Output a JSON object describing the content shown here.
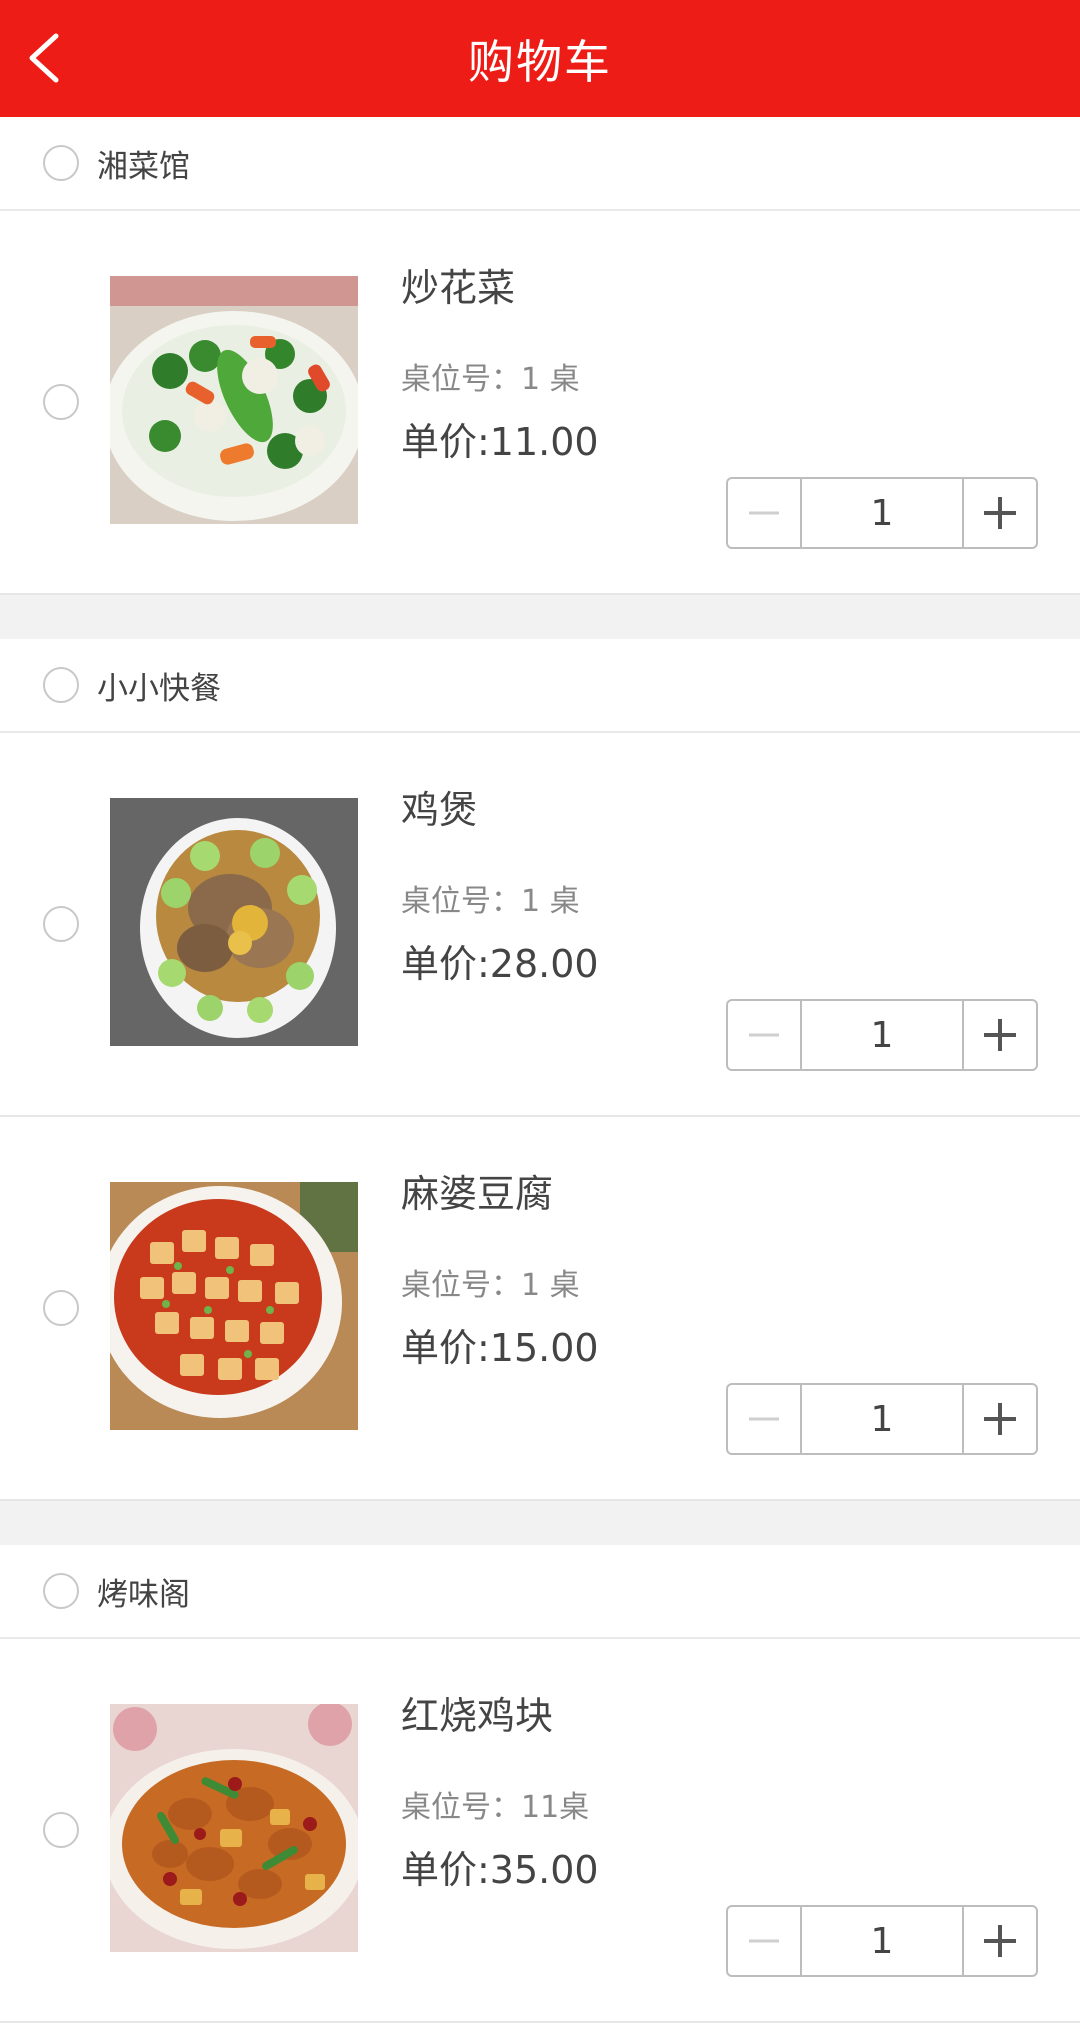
{
  "header": {
    "title": "购物车"
  },
  "shops": [
    {
      "name": "湘菜馆",
      "items": [
        {
          "name": "炒花菜",
          "table": "桌位号：1 桌",
          "price": "单价:11.00",
          "qty": "1",
          "image": "cauliflower"
        }
      ]
    },
    {
      "name": "小小快餐",
      "items": [
        {
          "name": "鸡煲",
          "table": "桌位号：1 桌",
          "price": "单价:28.00",
          "qty": "1",
          "image": "chicken-pot"
        },
        {
          "name": "麻婆豆腐",
          "table": "桌位号：1 桌",
          "price": "单价:15.00",
          "qty": "1",
          "image": "mapo-tofu"
        }
      ]
    },
    {
      "name": "烤味阁",
      "items": [
        {
          "name": "红烧鸡块",
          "table": "桌位号：11桌",
          "price": "单价:35.00",
          "qty": "1",
          "image": "braised-chicken"
        }
      ]
    }
  ],
  "icons": {
    "back": "chevron-left-icon",
    "minus": "minus-icon",
    "plus": "plus-icon",
    "checkbox": "radio-circle-icon"
  },
  "colors": {
    "brand": "#ee1c16"
  }
}
